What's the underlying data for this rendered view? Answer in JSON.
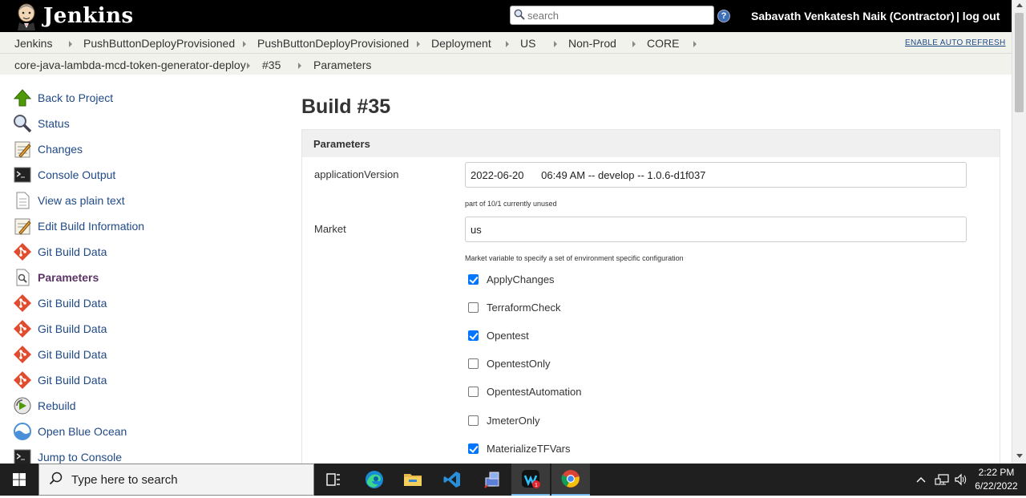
{
  "header": {
    "logo_text": "Jenkins",
    "search_placeholder": "search",
    "help_label": "?",
    "user_name": "Sabavath Venkatesh Naik (Contractor)",
    "logout_label": "| log out"
  },
  "breadcrumbs": {
    "row1": [
      "Jenkins",
      "PushButtonDeployProvisioned",
      "PushButtonDeployProvisioned",
      "Deployment",
      "US",
      "Non-Prod",
      "CORE"
    ],
    "row2": [
      "core-java-lambda-mcd-token-generator-deploy",
      "#35",
      "Parameters"
    ],
    "auto_refresh": "ENABLE AUTO REFRESH"
  },
  "sidebar": {
    "items": [
      {
        "label": "Back to Project",
        "icon": "up-arrow-icon"
      },
      {
        "label": "Status",
        "icon": "magnifier-icon"
      },
      {
        "label": "Changes",
        "icon": "notepad-icon"
      },
      {
        "label": "Console Output",
        "icon": "terminal-icon"
      },
      {
        "label": "View as plain text",
        "icon": "document-icon"
      },
      {
        "label": "Edit Build Information",
        "icon": "notepad-icon"
      },
      {
        "label": "Git Build Data",
        "icon": "git-icon"
      },
      {
        "label": "Parameters",
        "icon": "document-search-icon"
      },
      {
        "label": "Git Build Data",
        "icon": "git-icon"
      },
      {
        "label": "Git Build Data",
        "icon": "git-icon"
      },
      {
        "label": "Git Build Data",
        "icon": "git-icon"
      },
      {
        "label": "Git Build Data",
        "icon": "git-icon"
      },
      {
        "label": "Rebuild",
        "icon": "rebuild-icon"
      },
      {
        "label": "Open Blue Ocean",
        "icon": "blue-ocean-icon"
      },
      {
        "label": "Jump to Console",
        "icon": "terminal-icon"
      }
    ]
  },
  "main": {
    "title": "Build #35",
    "panel_title": "Parameters",
    "params": [
      {
        "name": "applicationVersion",
        "value": "2022-06-20      06:49 AM -- develop -- 1.0.6-d1f037",
        "help": "part of 10/1 currently unused"
      },
      {
        "name": "Market",
        "value": "us",
        "help": "Market variable to specify a set of environment specific configuration"
      }
    ],
    "checkboxes": [
      {
        "label": "ApplyChanges",
        "checked": true
      },
      {
        "label": "TerraformCheck",
        "checked": false
      },
      {
        "label": "Opentest",
        "checked": true
      },
      {
        "label": "OpentestOnly",
        "checked": false
      },
      {
        "label": "OpentestAutomation",
        "checked": false
      },
      {
        "label": "JmeterOnly",
        "checked": false
      },
      {
        "label": "MaterializeTFVars",
        "checked": true
      }
    ]
  },
  "taskbar": {
    "search_placeholder": "Type here to search",
    "time": "2:22 PM",
    "date": "6/22/2022",
    "badge": "1"
  },
  "colors": {
    "link": "#204a87",
    "header_bg": "#000000",
    "breadcrumb_bg": "#f2f2ed",
    "checkbox_checked": "#0075ff"
  }
}
